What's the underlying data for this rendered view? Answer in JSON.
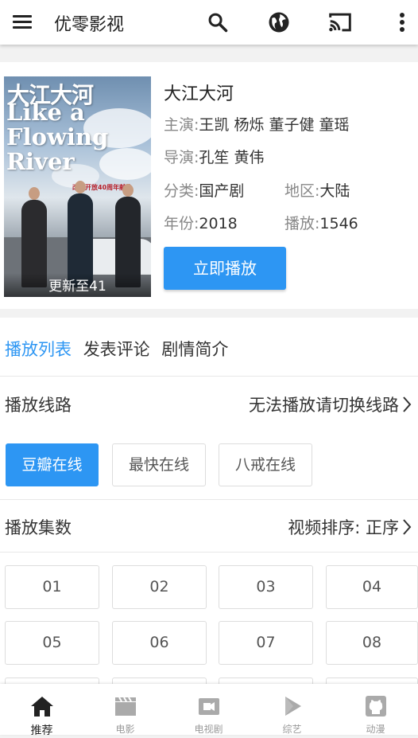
{
  "app": {
    "title": "优零影视"
  },
  "movie": {
    "title": "大江大河",
    "poster": {
      "title_cn": "大江大河",
      "title_en": "Like a Flowing River",
      "tagline": "改革开放40周年献礼",
      "update": "更新至41"
    },
    "cast_label": "主演:",
    "cast": "王凯 杨烁 董子健 童瑶",
    "director_label": "导演:",
    "director": "孔笙 黄伟",
    "genre_label": "分类:",
    "genre": "国产剧",
    "region_label": "地区:",
    "region": "大陆",
    "year_label": "年份:",
    "year": "2018",
    "plays_label": "播放:",
    "plays": "1546",
    "play_button": "立即播放"
  },
  "tabs": [
    "播放列表",
    "发表评论",
    "剧情简介"
  ],
  "lines": {
    "label": "播放线路",
    "hint": "无法播放请切换线路",
    "items": [
      "豆瓣在线",
      "最快在线",
      "八戒在线"
    ]
  },
  "episodes": {
    "label": "播放集数",
    "sort": "视频排序: 正序",
    "items": [
      "01",
      "02",
      "03",
      "04",
      "05",
      "06",
      "07",
      "08"
    ]
  },
  "nav": [
    "推荐",
    "电影",
    "电视剧",
    "综艺",
    "动漫"
  ],
  "colors": {
    "accent": "#2d96f3",
    "appbar": "#ffffff",
    "background": "#f2f2f2"
  },
  "icons": [
    "menu-icon",
    "search-icon",
    "globe-icon",
    "cast-icon",
    "more-vert-icon",
    "home-icon",
    "film-clapper-icon",
    "tv-camera-icon",
    "play-icon",
    "github-icon"
  ]
}
